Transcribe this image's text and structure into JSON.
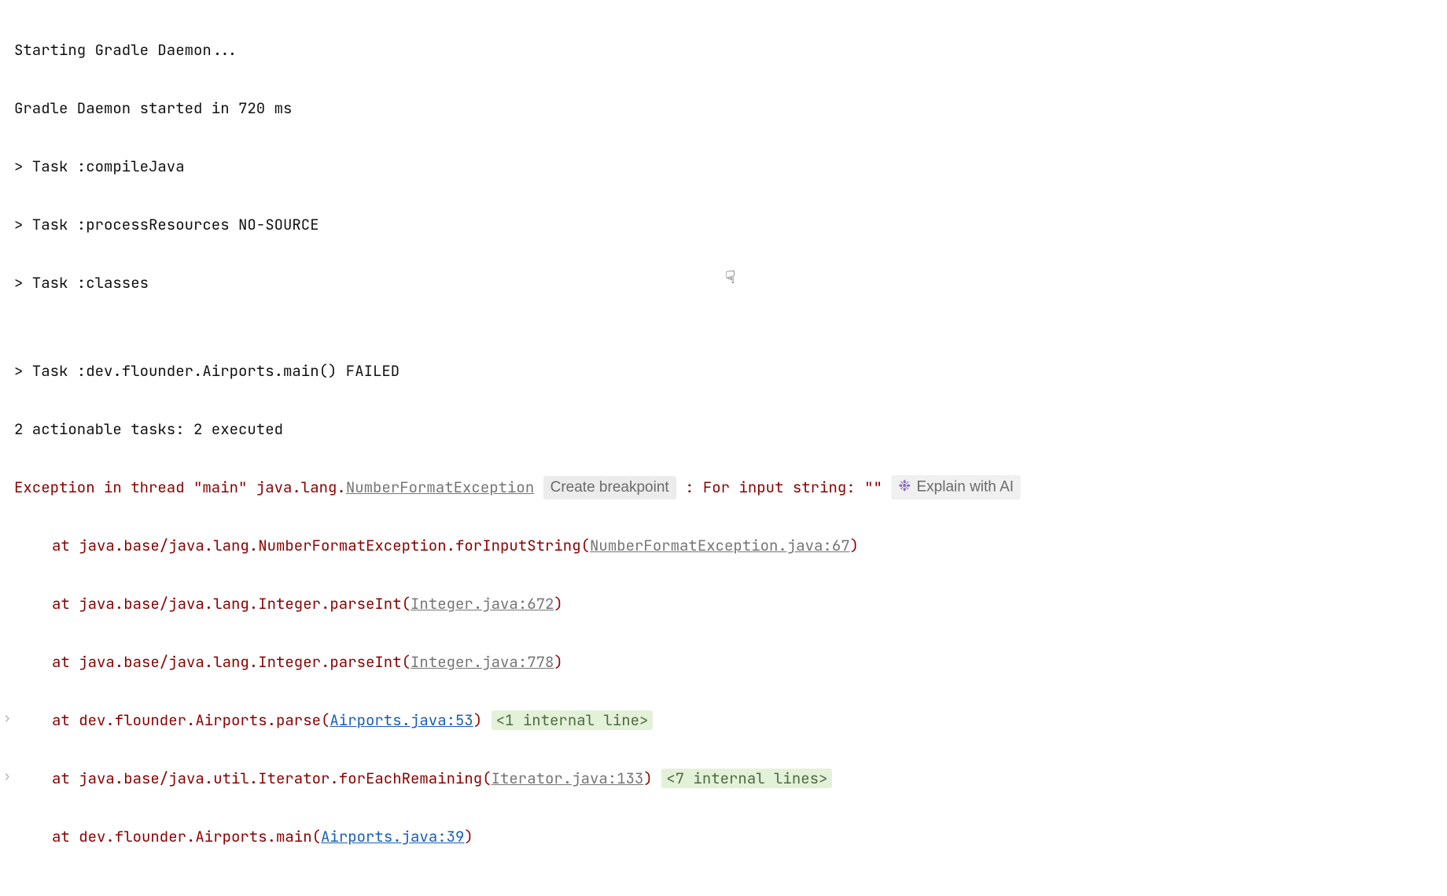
{
  "lines": {
    "l0": "Starting Gradle Daemon...",
    "l1": "Gradle Daemon started in 720 ms",
    "l2": "> Task :compileJava",
    "l3": "> Task :processResources NO-SOURCE",
    "l4": "> Task :classes",
    "l5": "",
    "l6": "> Task :dev.flounder.Airports.main() FAILED",
    "l7": "2 actionable tasks: 2 executed"
  },
  "exception": {
    "prefix": "Exception in thread \"main\" java.lang.",
    "class": "NumberFormatException",
    "breakpoint": "Create breakpoint",
    "mid": " : For input string: \"\" ",
    "explain": "Explain with AI"
  },
  "frames": {
    "f1_pre": "at java.base/java.lang.NumberFormatException.forInputString(",
    "f1_link": "NumberFormatException.java:67",
    "f1_post": ")",
    "f2_pre": "at java.base/java.lang.Integer.parseInt(",
    "f2_link": "Integer.java:672",
    "f2_post": ")",
    "f3_pre": "at java.base/java.lang.Integer.parseInt(",
    "f3_link": "Integer.java:778",
    "f3_post": ")",
    "f4_pre": "at dev.flounder.Airports.parse(",
    "f4_link": "Airports.java:53",
    "f4_post": ")",
    "f4_fold": "<1 internal line>",
    "f5_pre": "at java.base/java.util.Iterator.forEachRemaining(",
    "f5_link": "Iterator.java:133",
    "f5_post": ")",
    "f5_fold": "<7 internal lines>",
    "f6_pre": "at dev.flounder.Airports.main(",
    "f6_link": "Airports.java:39",
    "f6_post": ")"
  },
  "icons": {
    "chevron": "›",
    "ai": "❉",
    "cursor": "☟"
  }
}
